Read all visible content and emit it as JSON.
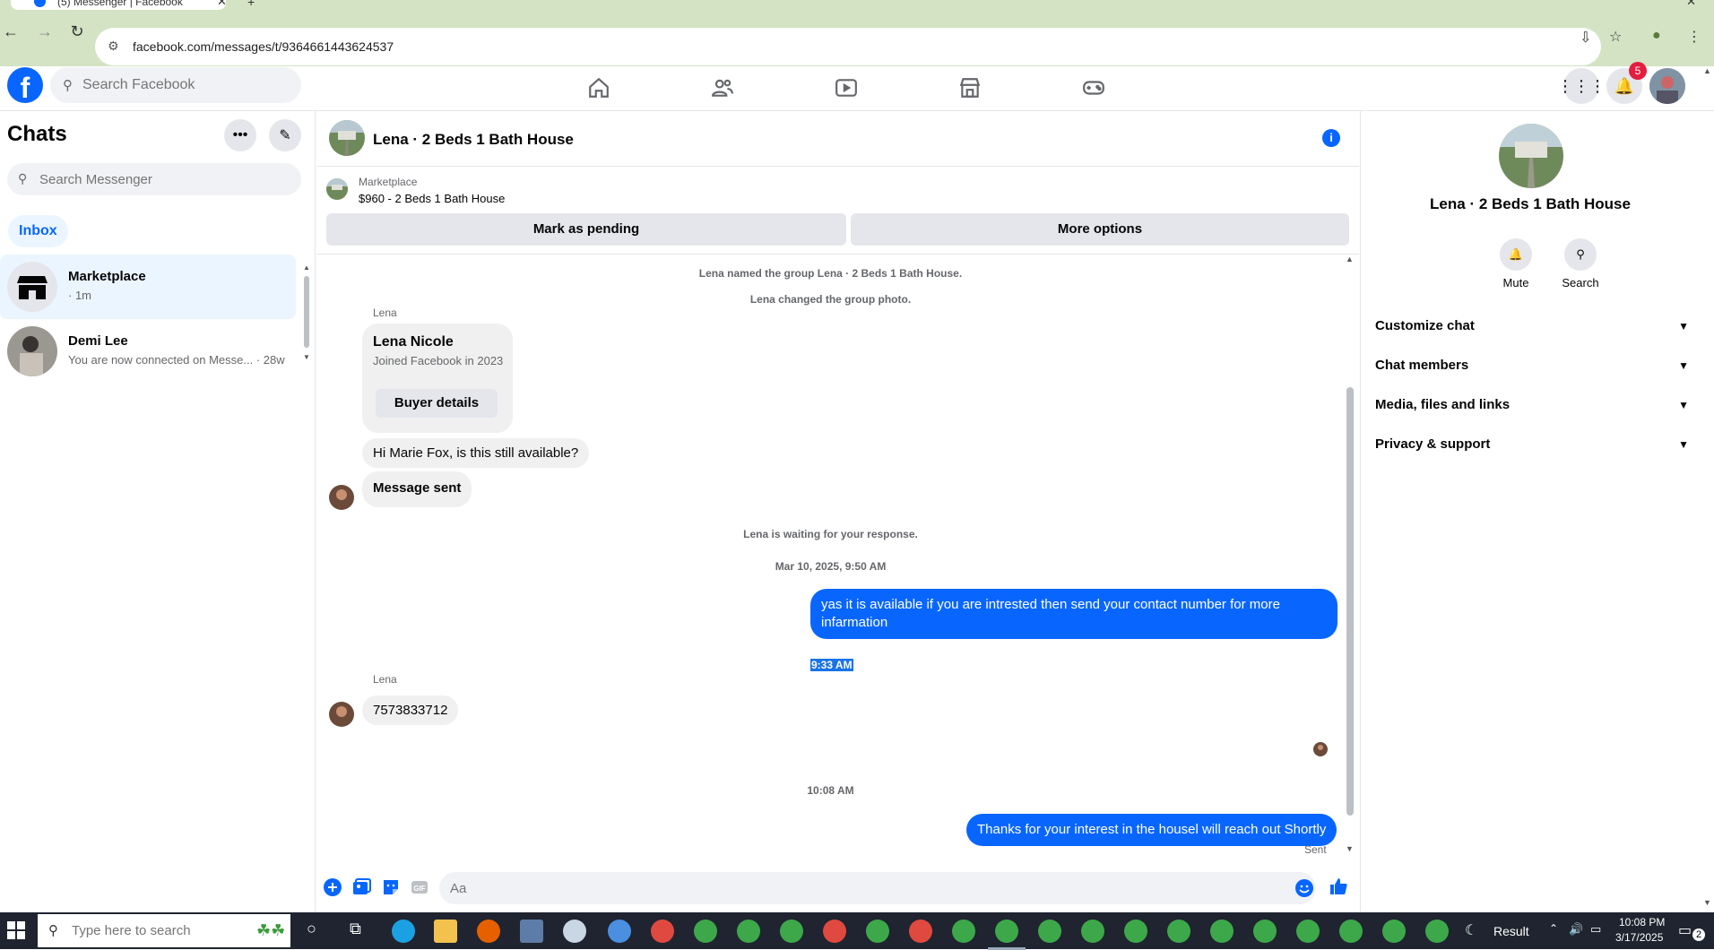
{
  "browser": {
    "tab_title": "(5) Messenger | Facebook",
    "url": "facebook.com/messages/t/9364661443624537"
  },
  "header": {
    "logo_letter": "f",
    "search_placeholder": "Search Facebook",
    "notification_count": "5"
  },
  "sidebar": {
    "title": "Chats",
    "search_placeholder": "Search Messenger",
    "filter": "Inbox",
    "chats": [
      {
        "name": "Marketplace",
        "preview": "· 1m",
        "active": true
      },
      {
        "name": "Demi Lee",
        "preview": "You are now connected on Messe... · 28w",
        "active": false
      }
    ]
  },
  "conversation": {
    "title": "Lena · 2 Beds 1 Bath House",
    "marketplace_label": "Marketplace",
    "listing": "$960 - 2 Beds 1 Bath House",
    "mark_pending": "Mark as pending",
    "more_options": "More options",
    "system_messages": [
      "Lena named the group Lena · 2 Beds 1 Bath House.",
      "Lena changed the group photo.",
      "Lena is waiting for your response."
    ],
    "sender_name": "Lena",
    "card": {
      "name": "Lena Nicole",
      "joined": "Joined Facebook in 2023",
      "button": "Buyer details"
    },
    "msg_in_1": "Hi Marie Fox, is this still available?",
    "msg_in_2": "Message sent",
    "timestamp_1": "Mar 10, 2025, 9:50 AM",
    "msg_out_1": "yas it is available if you are intrested then send your contact number for more infarmation",
    "timestamp_selected": "9:33 AM",
    "msg_in_3": "7573833712",
    "timestamp_2": "10:08 AM",
    "msg_out_2": "Thanks for your interest in the housel will reach out Shortly",
    "sent_status": "Sent",
    "composer_placeholder": "Aa"
  },
  "right_panel": {
    "title": "Lena · 2 Beds 1 Bath House",
    "actions": [
      {
        "label": "Mute",
        "icon": "bell-icon"
      },
      {
        "label": "Search",
        "icon": "search-icon"
      }
    ],
    "sections": [
      "Customize chat",
      "Chat members",
      "Media, files and links",
      "Privacy & support"
    ]
  },
  "taskbar": {
    "search_placeholder": "Type here to search",
    "tray_label": "Result",
    "time": "10:08 PM",
    "date": "3/17/2025",
    "notif_count": "2"
  },
  "colors": {
    "brand": "#0866ff",
    "bubble_in": "#f0f0f0",
    "chrome": "#d3e3c4"
  }
}
